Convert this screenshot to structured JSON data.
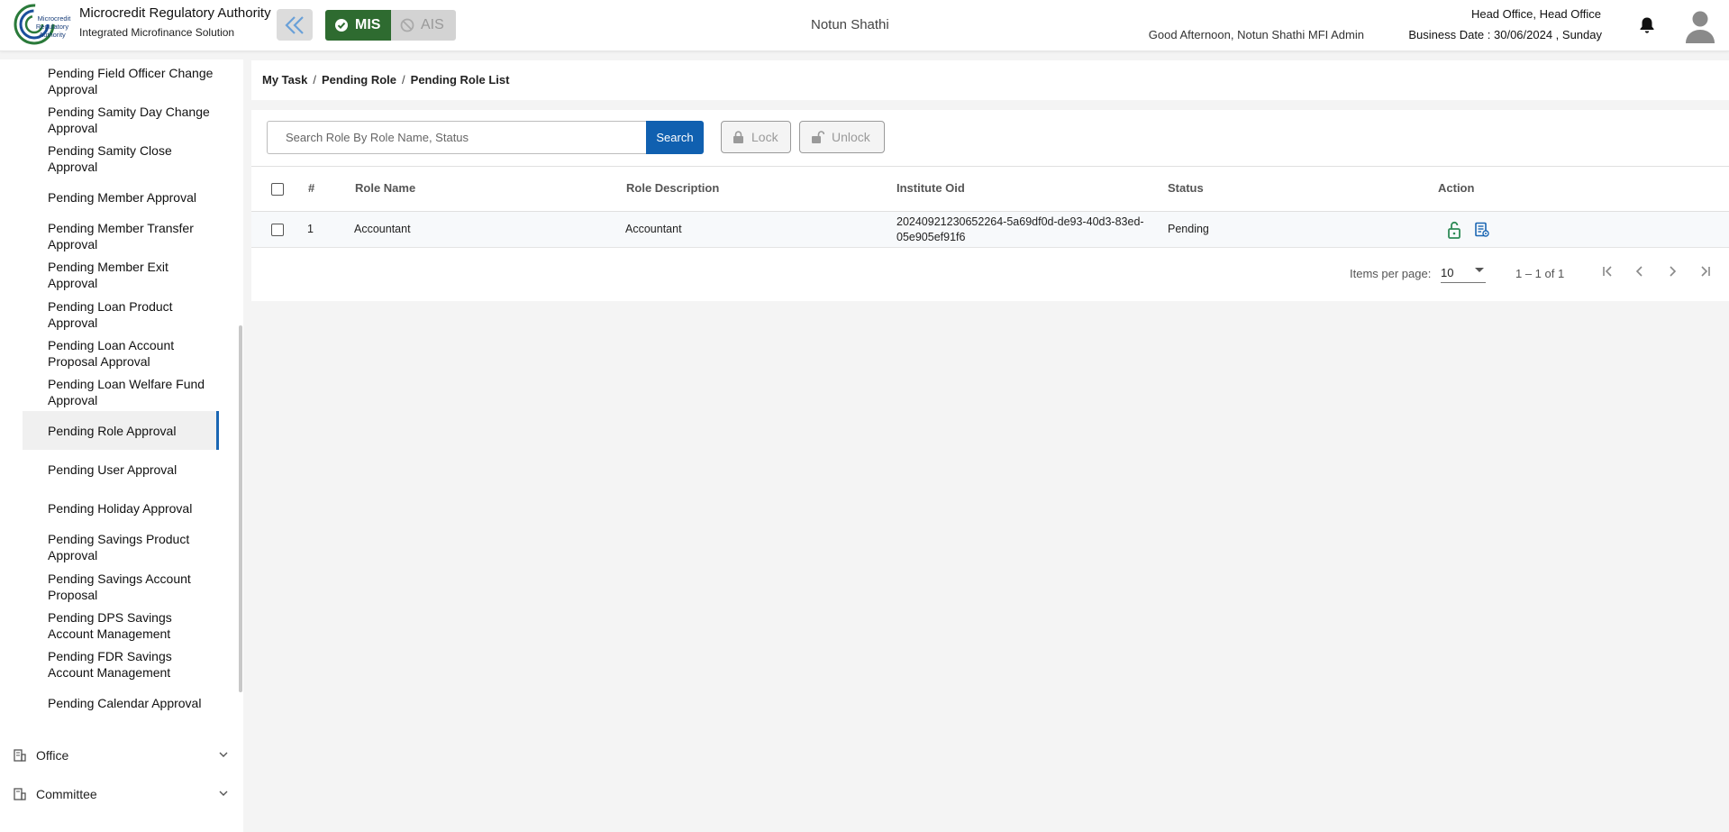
{
  "header": {
    "brand_title": "Microcredit Regulatory Authority",
    "brand_subtitle": "Integrated Microfinance Solution",
    "logo_text": [
      "Microcredit",
      "Regulatory",
      "Authority"
    ],
    "mode_mis": "MIS",
    "mode_ais": "AIS",
    "center_name": "Notun Shathi",
    "greeting": "Good Afternoon, Notun Shathi MFI Admin",
    "office": "Head Office, Head Office",
    "business_date": "Business Date : 30/06/2024 , Sunday"
  },
  "sidebar": {
    "items": [
      {
        "label": "Pending Field Officer Change Approval"
      },
      {
        "label": "Pending Samity Day Change Approval"
      },
      {
        "label": "Pending Samity Close Approval"
      },
      {
        "label": "Pending Member Approval"
      },
      {
        "label": "Pending Member Transfer Approval"
      },
      {
        "label": "Pending Member Exit Approval"
      },
      {
        "label": "Pending Loan Product Approval"
      },
      {
        "label": "Pending Loan Account Proposal Approval"
      },
      {
        "label": "Pending Loan Welfare Fund Approval"
      },
      {
        "label": "Pending Role Approval"
      },
      {
        "label": "Pending User Approval"
      },
      {
        "label": "Pending Holiday Approval"
      },
      {
        "label": "Pending Savings Product Approval"
      },
      {
        "label": "Pending Savings Account Proposal"
      },
      {
        "label": "Pending DPS Savings Account Management"
      },
      {
        "label": "Pending FDR Savings Account Management"
      },
      {
        "label": "Pending Calendar Approval"
      }
    ],
    "groups": [
      {
        "label": "Office"
      },
      {
        "label": "Committee"
      }
    ]
  },
  "breadcrumb": {
    "items": [
      "My Task",
      "Pending Role",
      "Pending Role List"
    ],
    "separator": "/"
  },
  "toolbar": {
    "search_placeholder": "Search Role By Role Name, Status",
    "search_label": "Search",
    "lock_label": "Lock",
    "unlock_label": "Unlock"
  },
  "table": {
    "columns": [
      "#",
      "Role Name",
      "Role Description",
      "Institute Oid",
      "Status",
      "Action"
    ],
    "rows": [
      {
        "index": "1",
        "role_name": "Accountant",
        "role_description": "Accountant",
        "institute_oid_line1": "20240921230652264-5a69df0d-de93-40d3-83ed-",
        "institute_oid_line2": "05e905ef91f6",
        "status": "Pending"
      }
    ]
  },
  "pagination": {
    "items_per_page_label": "Items per page:",
    "items_per_page": "10",
    "range": "1 – 1 of 1"
  },
  "colors": {
    "accent_blue": "#1060b0",
    "mis_green": "#2e6b30",
    "action_green": "#2e8b57",
    "action_blue": "#1a66b3"
  }
}
